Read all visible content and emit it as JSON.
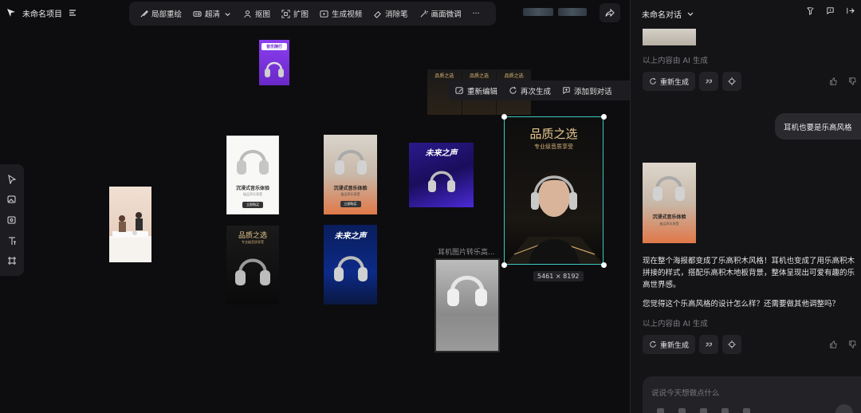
{
  "project": {
    "title": "未命名项目"
  },
  "toolbar": {
    "items": [
      {
        "label": "局部重绘",
        "icon": "brush-icon"
      },
      {
        "label": "超清",
        "icon": "hd-icon"
      },
      {
        "label": "抠图",
        "icon": "cutout-icon"
      },
      {
        "label": "扩图",
        "icon": "expand-icon"
      },
      {
        "label": "生成视频",
        "icon": "video-icon"
      },
      {
        "label": "消除笔",
        "icon": "eraser-icon"
      },
      {
        "label": "画面微调",
        "icon": "adjust-icon"
      }
    ],
    "more": "···"
  },
  "context_toolbar": {
    "items": [
      {
        "label": "重新编辑",
        "icon": "edit-icon"
      },
      {
        "label": "再次生成",
        "icon": "regenerate-icon"
      },
      {
        "label": "添加到对话",
        "icon": "add-to-chat-icon"
      }
    ]
  },
  "canvas": {
    "selected_size": "5461 × 8192",
    "lego_caption": "耳机图片转乐高...",
    "posters": {
      "purple_tag": "音乐随行",
      "white_title": "沉浸式音乐体验",
      "white_sub": "极品声乐享受",
      "white_btn": "立即购买",
      "lego1_title": "沉浸式音乐体验",
      "lego1_sub": "极品声乐享受",
      "lego1_btn": "立即购买",
      "future_title": "未来之声",
      "dark_title": "品质之选",
      "dark_sub": "专业级音质享受",
      "selected_title": "品质之选",
      "selected_sub": "专业级音质享受",
      "strip_title": "品质之选"
    }
  },
  "panel": {
    "title": "未命名对话",
    "ai_note": "以上内容由 AI 生成",
    "regenerate_label": "重新生成",
    "user_message": "耳机也要是乐高风格",
    "image_title": "沉浸式音乐体验",
    "image_sub": "极品声乐享受",
    "ai_reply_1": "现在整个海报都变成了乐高积木风格！耳机也变成了用乐高积木拼接的样式，搭配乐高积木地板背景，整体呈现出可爱有趣的乐高世界感。",
    "ai_reply_2": "您觉得这个乐高风格的设计怎么样？还需要做其他调整吗？",
    "input_placeholder": "说说今天想做点什么"
  },
  "colors": {
    "selection": "#3cc9c0",
    "gold": "#e8c890",
    "panel_bg": "#141417"
  }
}
